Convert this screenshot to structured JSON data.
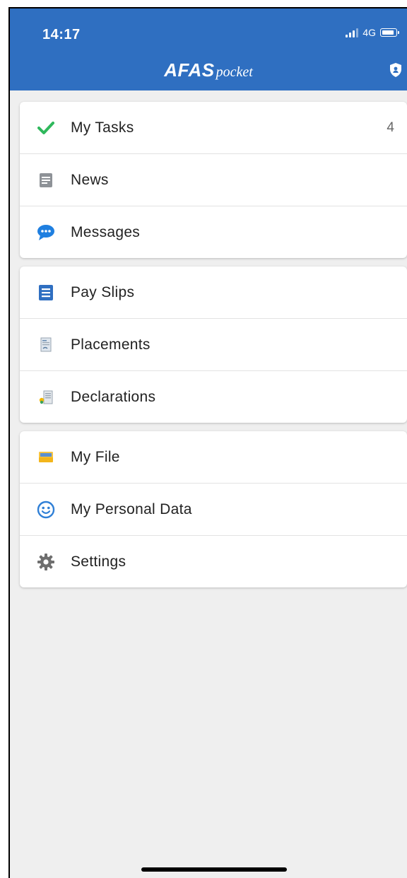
{
  "status_bar": {
    "time": "14:17",
    "network": "4G"
  },
  "header": {
    "brand": "AFAS",
    "brand_sub": "pocket"
  },
  "menu_groups": [
    {
      "items": [
        {
          "label": "My Tasks",
          "icon": "checkmark-icon",
          "count": "4"
        },
        {
          "label": "News",
          "icon": "news-icon"
        },
        {
          "label": "Messages",
          "icon": "chat-bubble-icon"
        }
      ]
    },
    {
      "items": [
        {
          "label": "Pay Slips",
          "icon": "document-icon"
        },
        {
          "label": "Placements",
          "icon": "placement-doc-icon"
        },
        {
          "label": "Declarations",
          "icon": "declaration-icon"
        }
      ]
    },
    {
      "items": [
        {
          "label": "My File",
          "icon": "folder-icon"
        },
        {
          "label": "My Personal Data",
          "icon": "smiley-icon"
        },
        {
          "label": "Settings",
          "icon": "gear-icon"
        }
      ]
    }
  ],
  "colors": {
    "header_bg": "#2f6fc1",
    "check_green": "#2fb85c",
    "accent_blue": "#2f6fc1",
    "page_bg": "#efefef"
  }
}
